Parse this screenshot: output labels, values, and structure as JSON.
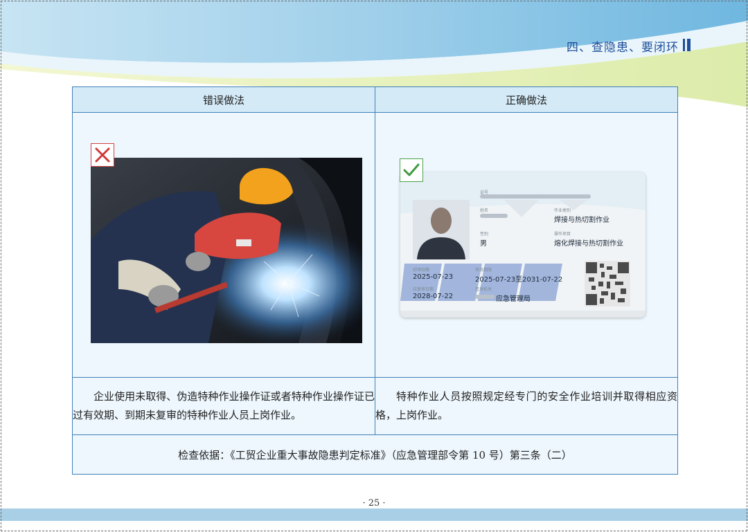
{
  "header": {
    "section_title": "四、查隐患、要闭环"
  },
  "table": {
    "columns": [
      "错误做法",
      "正确做法"
    ],
    "wrong": {
      "mark": "cross-icon",
      "image": "welder-without-certificate-photo",
      "description": "企业使用未取得、伪造特种作业操作证或者特种作业操作证已过有效期、到期未复审的特种作业人员上岗作业。"
    },
    "right": {
      "mark": "check-icon",
      "image": "special-operation-certificate-card",
      "card": {
        "operation_category": "焊接与热切割作业",
        "gender": "男",
        "operation_item": "熔化焊接与热切割作业",
        "first_issue_date": "2025-07-23",
        "validity": "2025-07-23至2031-07-22",
        "review_date": "2028-07-22",
        "issuing_authority": "应急管理局"
      },
      "description": "特种作业人员按照规定经专门的安全作业培训并取得相应资格，上岗作业。"
    },
    "basis": "检查依据：《工贸企业重大事故隐患判定标准》（应急管理部令第 10 号）第三条（二）"
  },
  "footer": {
    "page_number": "· 25 ·"
  },
  "colors": {
    "border": "#3f7fb8",
    "header_cell": "#d4eaf7",
    "cell_bg": "#eef7fd",
    "title_blue": "#1f4f9a",
    "wrong_red": "#d04040",
    "right_green": "#4ea24e"
  }
}
